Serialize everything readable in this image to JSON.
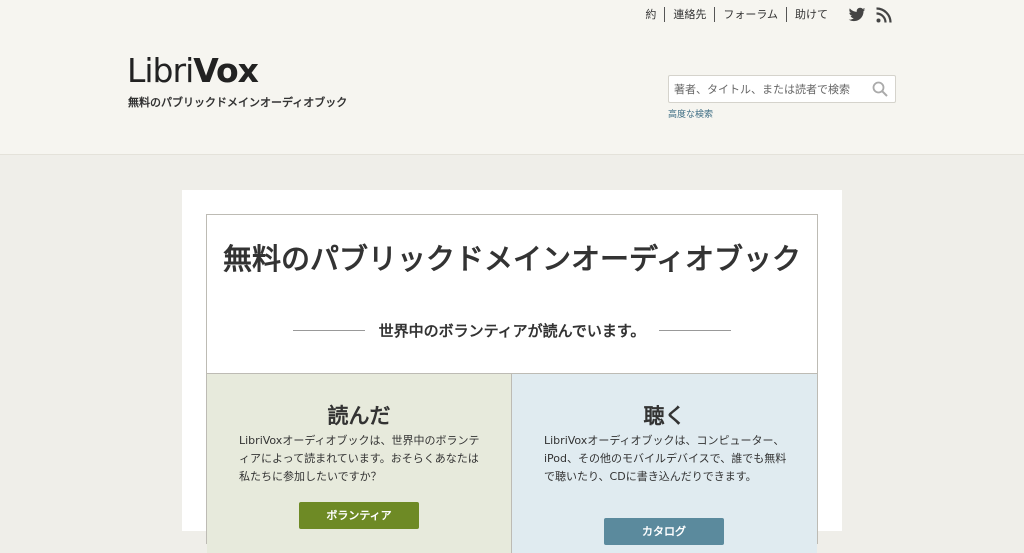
{
  "top_nav": {
    "items": [
      "約",
      "連絡先",
      "フォーラム",
      "助けて"
    ]
  },
  "social": {
    "icons": [
      "twitter-icon",
      "rss-icon"
    ],
    "color": "#444444"
  },
  "branding": {
    "logo_part1": "Libri",
    "logo_part2": "Vox",
    "tagline": "無料のパブリックドメインオーディオブック"
  },
  "search": {
    "placeholder": "著者、タイトル、または読者で検索",
    "advanced_link": "高度な検索"
  },
  "hero": {
    "title": "無料のパブリックドメインオーディオブック",
    "subtitle": "世界中のボランティアが読んでいます。"
  },
  "read_section": {
    "title": "読んだ",
    "text": "LibriVoxオーディオブックは、世界中のボランティアによって読まれています。おそらくあなたは私たちに参加したいですか？",
    "button": "ボランティア",
    "accent": "#6e8a25"
  },
  "listen_section": {
    "title": "聴く",
    "text": "LibriVoxオーディオブックは、コンピューター、iPod、その他のモバイルデバイスで、誰でも無料で聴いたり、CDに書き込んだりできます。",
    "button": "カタログ",
    "accent": "#5b8a9d"
  }
}
